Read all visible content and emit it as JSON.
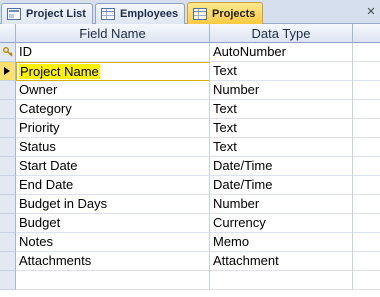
{
  "tabs": [
    {
      "label": "Project List",
      "icon": "form-icon",
      "active": false
    },
    {
      "label": "Employees",
      "icon": "table-icon",
      "active": false
    },
    {
      "label": "Projects",
      "icon": "table-icon",
      "active": true
    }
  ],
  "close_icon": "close-icon",
  "columns": {
    "field_name": "Field Name",
    "data_type": "Data Type",
    "description": ""
  },
  "fields": [
    {
      "name": "ID",
      "type": "AutoNumber",
      "primary_key": true
    },
    {
      "name": "Project Name",
      "type": "Text",
      "current": true
    },
    {
      "name": "Owner",
      "type": "Number"
    },
    {
      "name": "Category",
      "type": "Text"
    },
    {
      "name": "Priority",
      "type": "Text"
    },
    {
      "name": "Status",
      "type": "Text"
    },
    {
      "name": "Start Date",
      "type": "Date/Time"
    },
    {
      "name": "End Date",
      "type": "Date/Time"
    },
    {
      "name": "Budget in Days",
      "type": "Number"
    },
    {
      "name": "Budget",
      "type": "Currency"
    },
    {
      "name": "Notes",
      "type": "Memo"
    },
    {
      "name": "Attachments",
      "type": "Attachment"
    },
    {
      "name": "",
      "type": ""
    }
  ],
  "colors": {
    "active_tab": "#ffc83d",
    "current_row_highlight": "#fff200"
  }
}
